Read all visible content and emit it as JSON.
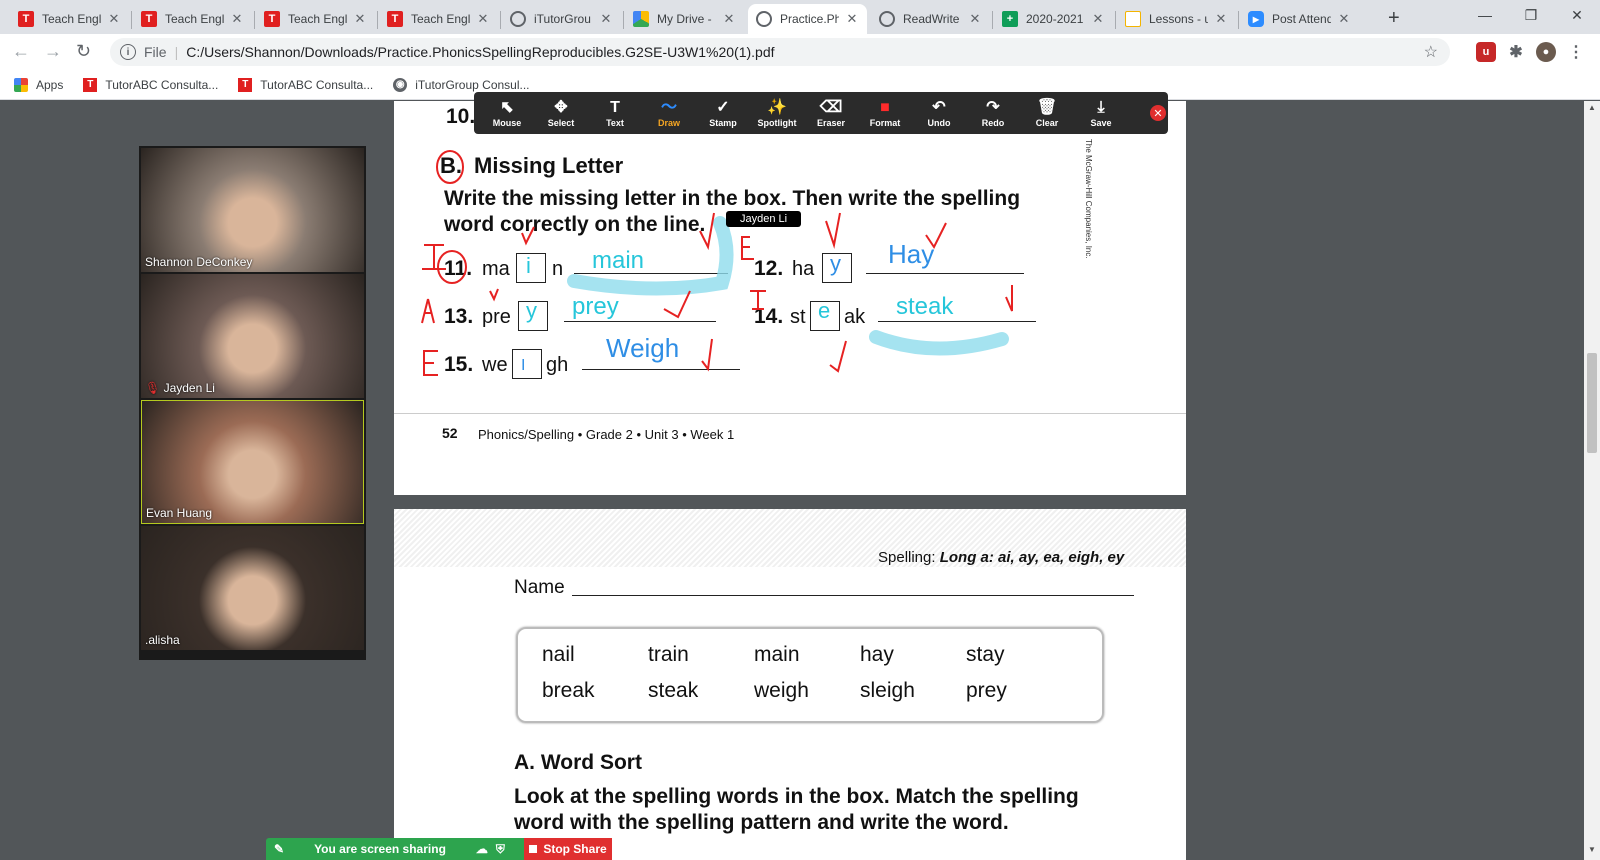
{
  "tabs": [
    {
      "title": "Teach Engli",
      "icon": "tutorabc-icon",
      "color": "#e02020"
    },
    {
      "title": "Teach Engli",
      "icon": "tutorabc-icon",
      "color": "#e02020"
    },
    {
      "title": "Teach Engli",
      "icon": "tutorabc-icon",
      "color": "#e02020"
    },
    {
      "title": "Teach Engli",
      "icon": "tutorabc-icon",
      "color": "#e02020"
    },
    {
      "title": "iTutorGrou",
      "icon": "globe-icon",
      "color": "#5f6368"
    },
    {
      "title": "My Drive -",
      "icon": "drive-icon",
      "color": "#1a73e8"
    },
    {
      "title": "Practice.Ph",
      "icon": "globe-icon",
      "color": "#5f6368"
    },
    {
      "title": "ReadWrite",
      "icon": "globe-icon",
      "color": "#5f6368"
    },
    {
      "title": "2020-2021",
      "icon": "sheets-icon",
      "color": "#0f9d58"
    },
    {
      "title": "Lessons - u",
      "icon": "lessons-icon",
      "color": "#f4b400"
    },
    {
      "title": "Post Attend",
      "icon": "zoom-icon",
      "color": "#2d8cff"
    }
  ],
  "address": {
    "scheme": "File",
    "url": "C:/Users/Shannon/Downloads/Practice.PhonicsSpellingReproducibles.G2SE-U3W1%20(1).pdf"
  },
  "bookmarks": {
    "apps": "Apps",
    "items": [
      "TutorABC Consulta...",
      "TutorABC Consulta...",
      "iTutorGroup Consul..."
    ]
  },
  "annotation_toolbar": {
    "tools": [
      {
        "label": "Mouse",
        "icon": "pointer-icon",
        "glyph": "⬉"
      },
      {
        "label": "Select",
        "icon": "move-icon",
        "glyph": "✥"
      },
      {
        "label": "Text",
        "icon": "text-icon",
        "glyph": "T"
      },
      {
        "label": "Draw",
        "icon": "draw-icon",
        "glyph": "〜",
        "selected": true
      },
      {
        "label": "Stamp",
        "icon": "stamp-icon",
        "glyph": "✓"
      },
      {
        "label": "Spotlight",
        "icon": "spotlight-icon",
        "glyph": "✨"
      },
      {
        "label": "Eraser",
        "icon": "eraser-icon",
        "glyph": "⌫"
      },
      {
        "label": "Format",
        "icon": "format-icon",
        "glyph": "■"
      },
      {
        "label": "Undo",
        "icon": "undo-icon",
        "glyph": "↶"
      },
      {
        "label": "Redo",
        "icon": "redo-icon",
        "glyph": "↷"
      },
      {
        "label": "Clear",
        "icon": "trash-icon",
        "glyph": "🗑"
      },
      {
        "label": "Save",
        "icon": "save-icon",
        "glyph": "⤓"
      }
    ],
    "format_color": "#ff2b2b"
  },
  "participants": [
    {
      "name": "Shannon DeConkey",
      "bg": "#8a7c72"
    },
    {
      "name": "Jayden Li",
      "bg": "#6d5a54",
      "muted": true
    },
    {
      "name": "Evan Huang",
      "bg": "#9b6b55",
      "active": true
    },
    {
      "name": ".alisha",
      "bg": "#3b302a"
    }
  ],
  "worksheet1": {
    "q10": "10.",
    "section_letter": "B.",
    "section_title": "Missing Letter",
    "instructions_1": "Write the missing letter in the box. Then write the spelling",
    "instructions_2": "word correctly on the line.",
    "items": [
      {
        "num": "11.",
        "before": "ma",
        "after": "n",
        "letter": "i",
        "answer": "main"
      },
      {
        "num": "12.",
        "before": "ha",
        "after": "",
        "letter": "y",
        "answer": "Hay"
      },
      {
        "num": "13.",
        "before": "pre",
        "after": "",
        "letter": "y",
        "answer": "prey"
      },
      {
        "num": "14.",
        "before": "st",
        "after": "ak",
        "letter": "e",
        "answer": "steak"
      },
      {
        "num": "15.",
        "before": "we",
        "after": "gh",
        "letter": "I",
        "answer": "Weigh"
      }
    ],
    "side_credit": "The McGraw-Hill Companies, Inc.",
    "footer_page": "52",
    "footer_text": "Phonics/Spelling • Grade 2 • Unit 3 • Week 1",
    "cursor_tag": "Jayden Li"
  },
  "worksheet2": {
    "header_prefix": "Spelling: ",
    "header_bold": "Long a: ai, ay, ea, eigh, ey",
    "name_label": "Name",
    "words_row1": [
      "nail",
      "train",
      "main",
      "hay",
      "stay"
    ],
    "words_row2": [
      "break",
      "steak",
      "weigh",
      "sleigh",
      "prey"
    ],
    "section_title": "A. Word Sort",
    "instructions_1": "Look at the spelling words in the box. Match the spelling",
    "instructions_2": "word with the spelling pattern and write the word."
  },
  "share": {
    "status": "You are screen sharing",
    "stop": "Stop Share"
  }
}
